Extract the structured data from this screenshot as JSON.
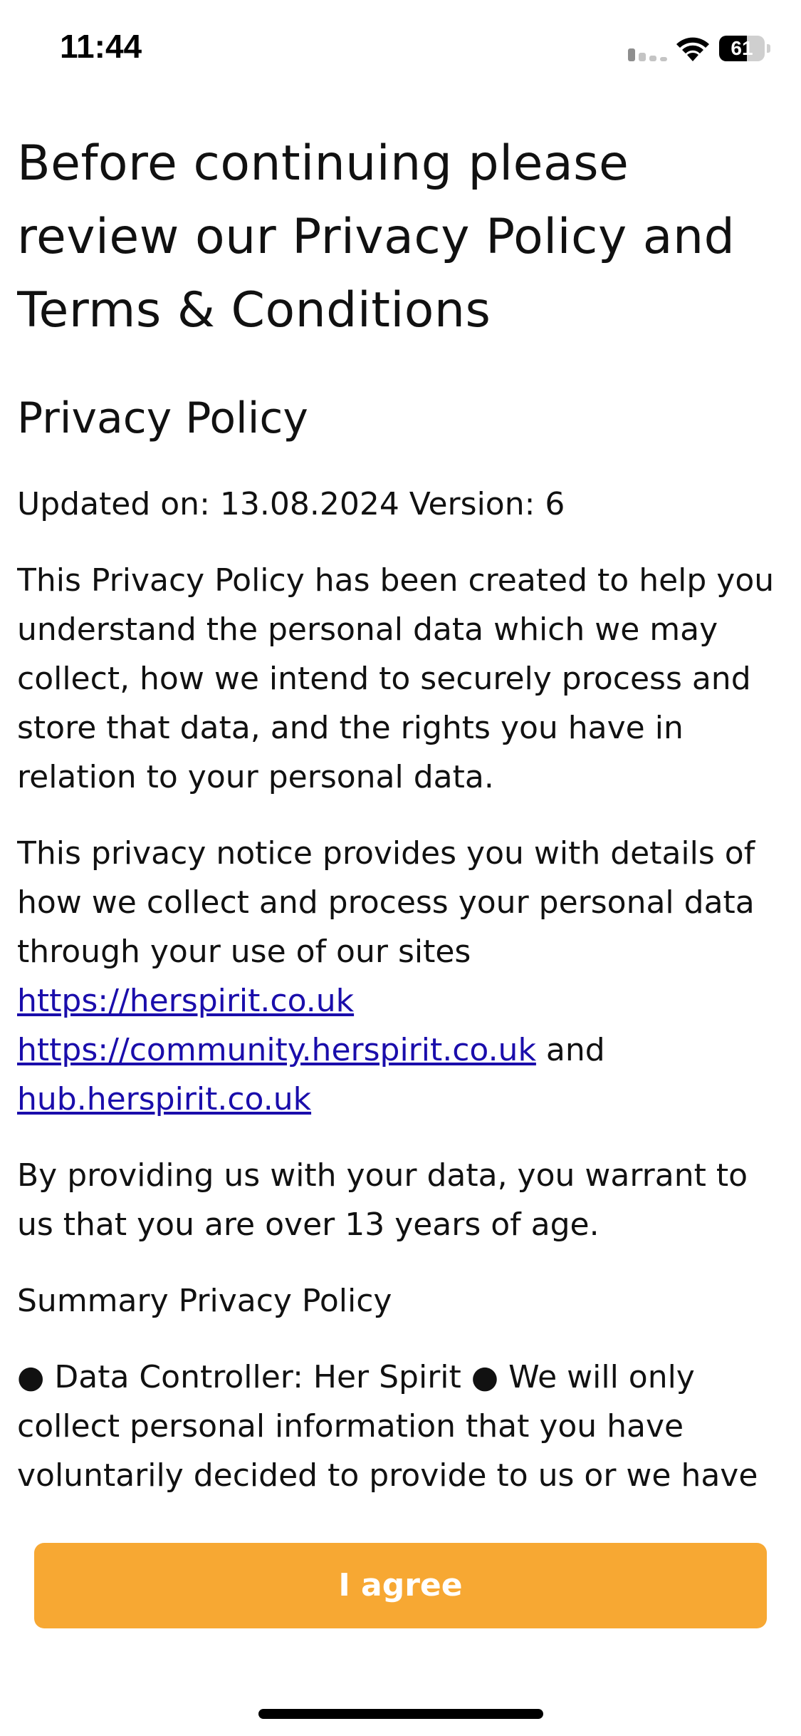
{
  "status_bar": {
    "time": "11:44",
    "battery_level": "61",
    "signal_icon": "cellular-signal-icon",
    "wifi_icon": "wifi-icon",
    "battery_icon": "battery-icon"
  },
  "header": {
    "title": "Before continuing please review our Privacy Policy and Terms & Conditions"
  },
  "policy": {
    "title": "Privacy Policy",
    "updated": "Updated on: 13.08.2024 Version: 6",
    "intro": "This Privacy Policy has been created to help you understand the personal data which we may collect, how we intend to securely process and store that data, and the rights you have in relation to your personal data.",
    "notice_text": "This privacy notice provides you with details of how we collect and process your personal data through your use of our sites",
    "link_1": "https://herspirit.co.uk",
    "link_2": "https://community.herspirit.co.uk",
    "and_text": "and",
    "link_3": "hub.herspirit.co.uk",
    "age_warrant": "By providing us with your data, you warrant to us that you are over 13 years of age.",
    "summary_title": "Summary Privacy Policy",
    "summary_text": "● Data Controller: Her Spirit ● We will only collect personal information that you have voluntarily decided to provide to us or we have"
  },
  "footer": {
    "agree_label": "I agree"
  },
  "colors": {
    "accent": "#f7a833",
    "link": "#1a0dab",
    "text": "#111111"
  }
}
